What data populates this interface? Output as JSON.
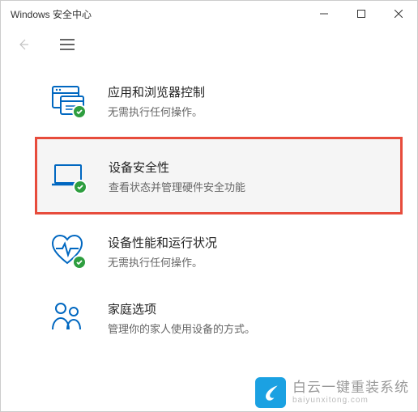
{
  "window": {
    "title": "Windows 安全中心"
  },
  "items": [
    {
      "title": "应用和浏览器控制",
      "desc": "无需执行任何操作。",
      "icon": "app-browser",
      "status": "ok"
    },
    {
      "title": "设备安全性",
      "desc": "查看状态并管理硬件安全功能",
      "icon": "device",
      "status": "ok",
      "highlighted": true
    },
    {
      "title": "设备性能和运行状况",
      "desc": "无需执行任何操作。",
      "icon": "health",
      "status": "ok"
    },
    {
      "title": "家庭选项",
      "desc": "管理你的家人使用设备的方式。",
      "icon": "family",
      "status": "none"
    }
  ],
  "watermark": {
    "title": "白云一键重装系统",
    "sub": "baiyunxitong.com"
  }
}
